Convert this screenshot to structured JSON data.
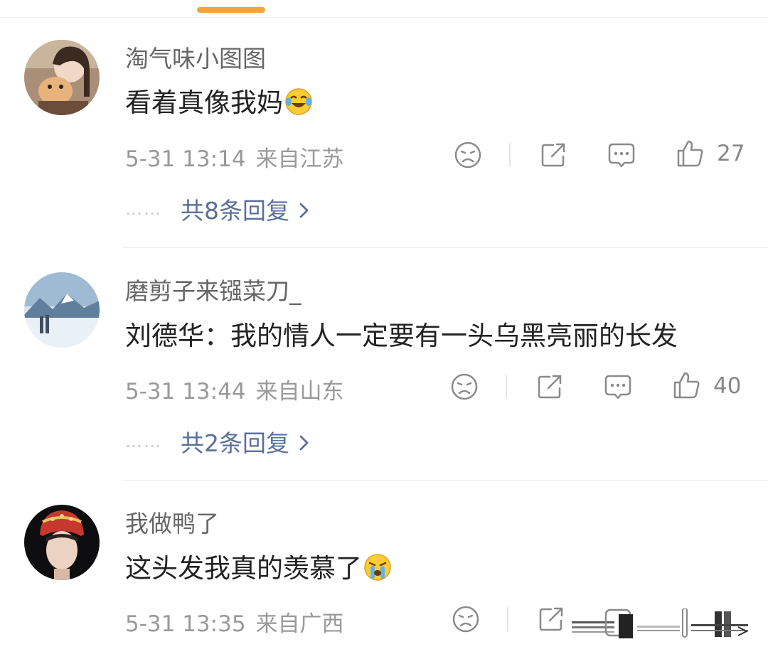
{
  "comments": [
    {
      "username": "淘气味小图图",
      "text": "看着真像我妈",
      "emoji": "laughing-crying-emoji",
      "date": "5-31 13:14",
      "location": "来自江苏",
      "likes": "27",
      "replies": "共8条回复"
    },
    {
      "username": "磨剪子来镪菜刀_",
      "text": "刘德华：我的情人一定要有一头乌黑亮丽的长发",
      "date": "5-31 13:44",
      "location": "来自山东",
      "likes": "40",
      "replies": "共2条回复"
    },
    {
      "username": "我做鸭了",
      "text": "这头发我真的羡慕了",
      "emoji": "crying-emoji",
      "date": "5-31 13:35",
      "location": "来自广西"
    }
  ],
  "reply_dots": "……",
  "colors": {
    "accent": "#f2a53a",
    "reply_link": "#5b6f9a",
    "meta": "#999999"
  },
  "icons": [
    "dislike-icon",
    "share-icon",
    "comment-icon",
    "like-icon",
    "chevron-right-icon"
  ]
}
